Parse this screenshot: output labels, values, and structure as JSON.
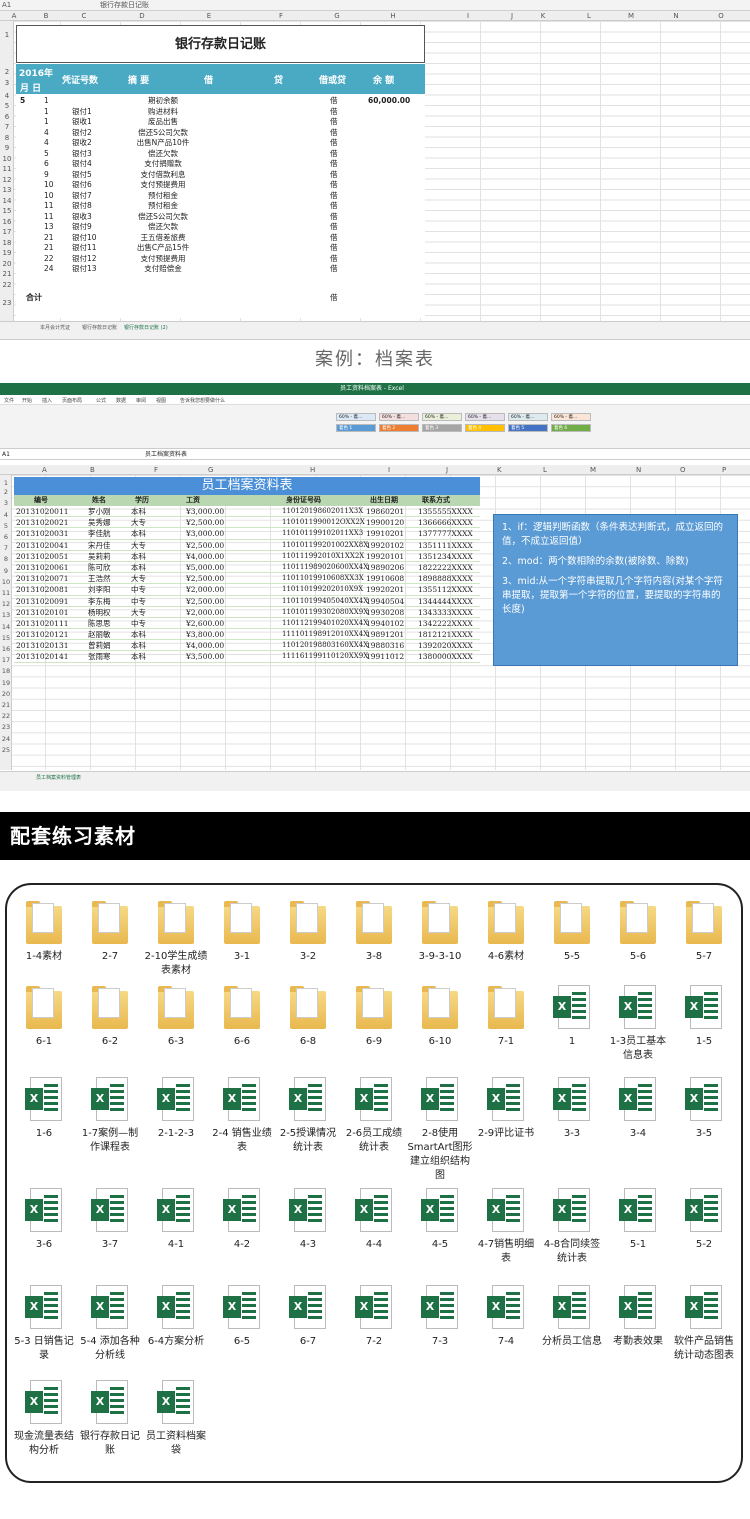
{
  "sheet1": {
    "cell_ref": "A1",
    "formula": "银行存款日记账",
    "columns": [
      "A",
      "B",
      "C",
      "D",
      "E",
      "F",
      "G",
      "H",
      "I",
      "J",
      "K",
      "L",
      "M",
      "N",
      "O"
    ],
    "rows": [
      "1",
      "2",
      "3",
      "4",
      "5",
      "6",
      "7",
      "8",
      "9",
      "10",
      "11",
      "12",
      "13",
      "14",
      "15",
      "16",
      "17",
      "18",
      "19",
      "20",
      "21",
      "22",
      "23"
    ],
    "title": "银行存款日记账",
    "header": {
      "year": "2016年",
      "month_day": "月  日",
      "voucher": "凭证号数",
      "summary": "摘  要",
      "debit": "借",
      "credit": "贷",
      "dc": "借或贷",
      "balance": "余  额"
    },
    "entries": [
      {
        "m": "5",
        "d": "1",
        "v": "",
        "s": "期初余额",
        "dc": "借",
        "bal": "60,000.00"
      },
      {
        "m": "",
        "d": "1",
        "v": "银付1",
        "s": "购进材料",
        "dc": "借",
        "bal": ""
      },
      {
        "m": "",
        "d": "1",
        "v": "银收1",
        "s": "废品出售",
        "dc": "借",
        "bal": ""
      },
      {
        "m": "",
        "d": "4",
        "v": "银付2",
        "s": "偿还S公司欠款",
        "dc": "借",
        "bal": ""
      },
      {
        "m": "",
        "d": "4",
        "v": "银收2",
        "s": "出售N产品10件",
        "dc": "借",
        "bal": ""
      },
      {
        "m": "",
        "d": "5",
        "v": "银付3",
        "s": "偿还欠款",
        "dc": "借",
        "bal": ""
      },
      {
        "m": "",
        "d": "6",
        "v": "银付4",
        "s": "支付捐赠款",
        "dc": "借",
        "bal": ""
      },
      {
        "m": "",
        "d": "9",
        "v": "银付5",
        "s": "支付借款利息",
        "dc": "借",
        "bal": ""
      },
      {
        "m": "",
        "d": "10",
        "v": "银付6",
        "s": "支付预提费用",
        "dc": "借",
        "bal": ""
      },
      {
        "m": "",
        "d": "10",
        "v": "银付7",
        "s": "预付租金",
        "dc": "借",
        "bal": ""
      },
      {
        "m": "",
        "d": "11",
        "v": "银付8",
        "s": "预付租金",
        "dc": "借",
        "bal": ""
      },
      {
        "m": "",
        "d": "11",
        "v": "银收3",
        "s": "偿还S公司欠款",
        "dc": "借",
        "bal": ""
      },
      {
        "m": "",
        "d": "13",
        "v": "银付9",
        "s": "偿还欠款",
        "dc": "借",
        "bal": ""
      },
      {
        "m": "",
        "d": "21",
        "v": "银付10",
        "s": "王五借差旅费",
        "dc": "借",
        "bal": ""
      },
      {
        "m": "",
        "d": "21",
        "v": "银付11",
        "s": "出售C产品15件",
        "dc": "借",
        "bal": ""
      },
      {
        "m": "",
        "d": "22",
        "v": "银付12",
        "s": "支付预提费用",
        "dc": "借",
        "bal": ""
      },
      {
        "m": "",
        "d": "24",
        "v": "银付13",
        "s": "支付赔偿金",
        "dc": "借",
        "bal": ""
      },
      {
        "m": "",
        "d": "",
        "v": "",
        "s": "",
        "dc": "",
        "bal": ""
      },
      {
        "m": "合计",
        "d": "",
        "v": "",
        "s": "",
        "dc": "借",
        "bal": ""
      }
    ],
    "tabs": [
      "本月会计凭证",
      "银行存款日记账",
      "银行存款日记账 (2)"
    ]
  },
  "case_title": "案例：档案表",
  "sheet2": {
    "window_title": "员工资料档案表 - Excel",
    "ribbon_tabs": [
      "文件",
      "开始",
      "插入",
      "页面布局",
      "公式",
      "数据",
      "审阅",
      "视图",
      "告诉我您想要做什么"
    ],
    "styles": [
      "60% - 着...",
      "60% - 着...",
      "60% - 着...",
      "60% - 着...",
      "60% - 着...",
      "60% - 着...",
      "着色 1",
      "着色 2",
      "着色 3",
      "着色 4",
      "着色 5",
      "着色 6"
    ],
    "cell_ref": "A1",
    "formula": "员工档案资料表",
    "columns": [
      "A",
      "B",
      "F",
      "G",
      "H",
      "I",
      "J",
      "K",
      "L",
      "M",
      "N",
      "O",
      "P"
    ],
    "title": "员工档案资料表",
    "header": [
      "编号",
      "姓名",
      "学历",
      "工资",
      "身份证号码",
      "出生日期",
      "联系方式"
    ],
    "rows": [
      [
        "20131020011",
        "罗小刚",
        "本科",
        "¥3,000.00",
        "110120198602011X3X",
        "19860201",
        "1355555XXXX"
      ],
      [
        "20131020021",
        "吴秀娜",
        "大专",
        "¥2,500.00",
        "1101011990012OXX2X",
        "19900120",
        "1366666XXXX"
      ],
      [
        "20131020031",
        "李佳航",
        "本科",
        "¥3,000.00",
        "110101199102011XX3",
        "19910201",
        "1377777XXXX"
      ],
      [
        "20131020041",
        "宋丹佳",
        "大专",
        "¥2,500.00",
        "110101199201002XX8X",
        "19920102",
        "1351111XXXX"
      ],
      [
        "20131020051",
        "吴莉莉",
        "本科",
        "¥4,000.00",
        "110111992010X1XX2X",
        "19920101",
        "1351234XXXX"
      ],
      [
        "20131020061",
        "陈可欣",
        "本科",
        "¥5,000.00",
        "110111989020600XX4X",
        "19890206",
        "1822222XXXX"
      ],
      [
        "20131020071",
        "王浩然",
        "大专",
        "¥2,500.00",
        "11011019910608XX3X",
        "19910608",
        "1898888XXXX"
      ],
      [
        "20131020081",
        "刘李阳",
        "中专",
        "¥2,000.00",
        "110110199202010X9X",
        "19920201",
        "1355112XXXX"
      ],
      [
        "20131020091",
        "李东梅",
        "中专",
        "¥2,500.00",
        "110110199405040XX4X",
        "19940504",
        "1344444XXXX"
      ],
      [
        "20131020101",
        "杨明权",
        "大专",
        "¥2,000.00",
        "110101199302080XX9X",
        "19930208",
        "1343333XXXX"
      ],
      [
        "20131020111",
        "陈思思",
        "中专",
        "¥2,600.00",
        "110112199401020XX4X",
        "19940102",
        "1342222XXXX"
      ],
      [
        "20131020121",
        "赵丽敏",
        "本科",
        "¥3,800.00",
        "111101198912010XX4X",
        "19891201",
        "1812121XXXX"
      ],
      [
        "20131020131",
        "曾莉娟",
        "本科",
        "¥4,000.00",
        "110120198803160XX4X",
        "19880316",
        "1392020XXXX"
      ],
      [
        "20131020141",
        "张雨寒",
        "本科",
        "¥3,500.00",
        "111161199110120XX9X",
        "19911012",
        "1380000XXXX"
      ]
    ],
    "row_numbers": [
      "1",
      "2",
      "3",
      "4",
      "5",
      "6",
      "7",
      "8",
      "9",
      "10",
      "11",
      "12",
      "13",
      "14",
      "15",
      "16",
      "17",
      "18",
      "19",
      "20",
      "21",
      "22",
      "23",
      "24",
      "25"
    ],
    "note": [
      "1、if：逻辑判断函数（条件表达判断式，成立返回的值，不成立返回值）",
      "2、mod：两个数相除的余数(被除数、除数)",
      "3、mid:从一个字符串提取几个字符内容(对某个字符串提取，提取第一个字符的位置，要提取的字符串的长度)"
    ],
    "tab": "员工档案资料管理表"
  },
  "section_title": "配套练习素材",
  "files": [
    {
      "name": "1-4素材",
      "type": "folder"
    },
    {
      "name": "2-7",
      "type": "folder"
    },
    {
      "name": "2-10学生成绩表素材",
      "type": "folder"
    },
    {
      "name": "3-1",
      "type": "folder"
    },
    {
      "name": "3-2",
      "type": "folder"
    },
    {
      "name": "3-8",
      "type": "folder"
    },
    {
      "name": "3-9-3-10",
      "type": "folder"
    },
    {
      "name": "4-6素材",
      "type": "folder"
    },
    {
      "name": "5-5",
      "type": "folder"
    },
    {
      "name": "5-6",
      "type": "folder"
    },
    {
      "name": "5-7",
      "type": "folder"
    },
    {
      "name": "6-1",
      "type": "folder"
    },
    {
      "name": "6-2",
      "type": "folder"
    },
    {
      "name": "6-3",
      "type": "folder"
    },
    {
      "name": "6-6",
      "type": "folder"
    },
    {
      "name": "6-8",
      "type": "folder"
    },
    {
      "name": "6-9",
      "type": "folder"
    },
    {
      "name": "6-10",
      "type": "folder"
    },
    {
      "name": "7-1",
      "type": "folder"
    },
    {
      "name": "1",
      "type": "excel"
    },
    {
      "name": "1-3员工基本信息表",
      "type": "excel"
    },
    {
      "name": "1-5",
      "type": "excel"
    },
    {
      "name": "1-6",
      "type": "excel"
    },
    {
      "name": "1-7案例—制作课程表",
      "type": "excel"
    },
    {
      "name": "2-1-2-3",
      "type": "excel"
    },
    {
      "name": "2-4 销售业绩表",
      "type": "excel"
    },
    {
      "name": "2-5授课情况统计表",
      "type": "excel"
    },
    {
      "name": "2-6员工成绩统计表",
      "type": "excel"
    },
    {
      "name": "2-8使用SmartArt图形建立组织结构图",
      "type": "excel"
    },
    {
      "name": "2-9评比证书",
      "type": "excel"
    },
    {
      "name": "3-3",
      "type": "excel"
    },
    {
      "name": "3-4",
      "type": "excel"
    },
    {
      "name": "3-5",
      "type": "excel"
    },
    {
      "name": "3-6",
      "type": "excel"
    },
    {
      "name": "3-7",
      "type": "excel"
    },
    {
      "name": "4-1",
      "type": "excel"
    },
    {
      "name": "4-2",
      "type": "excel"
    },
    {
      "name": "4-3",
      "type": "excel"
    },
    {
      "name": "4-4",
      "type": "excel"
    },
    {
      "name": "4-5",
      "type": "excel"
    },
    {
      "name": "4-7销售明细表",
      "type": "excel"
    },
    {
      "name": "4-8合同续签统计表",
      "type": "excel"
    },
    {
      "name": "5-1",
      "type": "excel"
    },
    {
      "name": "5-2",
      "type": "excel"
    },
    {
      "name": "5-3 日销售记录",
      "type": "excel"
    },
    {
      "name": "5-4 添加各种分析线",
      "type": "excel"
    },
    {
      "name": "6-4方案分析",
      "type": "excel"
    },
    {
      "name": "6-5",
      "type": "excel"
    },
    {
      "name": "6-7",
      "type": "excel"
    },
    {
      "name": "7-2",
      "type": "excel"
    },
    {
      "name": "7-3",
      "type": "excel"
    },
    {
      "name": "7-4",
      "type": "excel"
    },
    {
      "name": "分析员工信息",
      "type": "excel"
    },
    {
      "name": "考勤表效果",
      "type": "excel"
    },
    {
      "name": "软件产品销售统计动态图表",
      "type": "excel"
    },
    {
      "name": "现金流量表结构分析",
      "type": "excel"
    },
    {
      "name": "银行存款日记账",
      "type": "excel"
    },
    {
      "name": "员工资料档案袋",
      "type": "excel"
    }
  ]
}
